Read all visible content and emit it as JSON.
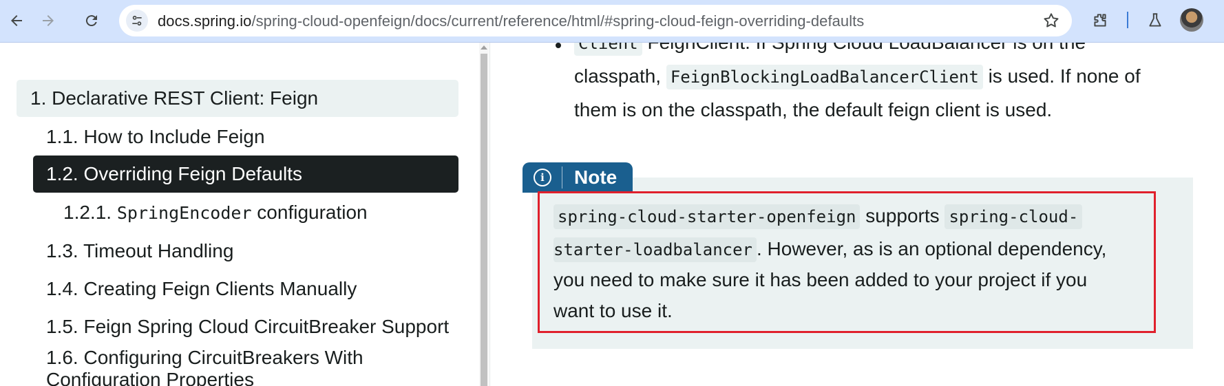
{
  "browser": {
    "url_host": "docs.spring.io",
    "url_path": "/spring-cloud-openfeign/docs/current/reference/html/#spring-cloud-feign-overriding-defaults"
  },
  "sidebar": {
    "items": [
      {
        "label": "1. Declarative REST Client: Feign",
        "level": 1,
        "active": false
      },
      {
        "label": "1.1. How to Include Feign",
        "level": 2,
        "active": false
      },
      {
        "label": "1.2. Overriding Feign Defaults",
        "level": 2,
        "active": true
      },
      {
        "prefix": "1.2.1. ",
        "code": "SpringEncoder",
        "suffix": " configuration",
        "level": 3,
        "active": false
      },
      {
        "label": "1.3. Timeout Handling",
        "level": 2,
        "active": false
      },
      {
        "label": "1.4. Creating Feign Clients Manually",
        "level": 2,
        "active": false
      },
      {
        "label": "1.5. Feign Spring Cloud CircuitBreaker Support",
        "level": 2,
        "active": false
      },
      {
        "label": "1.6. Configuring CircuitBreakers With",
        "label2": "Configuration Properties",
        "level": 2,
        "active": false
      }
    ]
  },
  "content": {
    "bullet": {
      "line1_code": "Client",
      "line1_text": " FeignClient. If Spring Cloud LoadBalancer is on the",
      "line2_pre": "classpath, ",
      "line2_code": "FeignBlockingLoadBalancerClient",
      "line2_post": " is used. If none of",
      "line3": "them is on the classpath, the default feign client is used."
    },
    "note": {
      "badge_label": "Note",
      "line1_code1": "spring-cloud-starter-openfeign",
      "line1_text": " supports ",
      "line1_code2": "spring-cloud-",
      "line2_code": "starter-loadbalancer",
      "line2_text": ". However, as is an optional dependency,",
      "line3": "you need to make sure it has been added to your project if you",
      "line4": "want to use it."
    }
  },
  "colors": {
    "toolbar_bg": "#d3e3fd",
    "toc_active_bg": "#1b2021",
    "note_badge_bg": "#1a5f8f",
    "note_bg": "#ebf2f2",
    "highlight_border": "#e0202c"
  }
}
